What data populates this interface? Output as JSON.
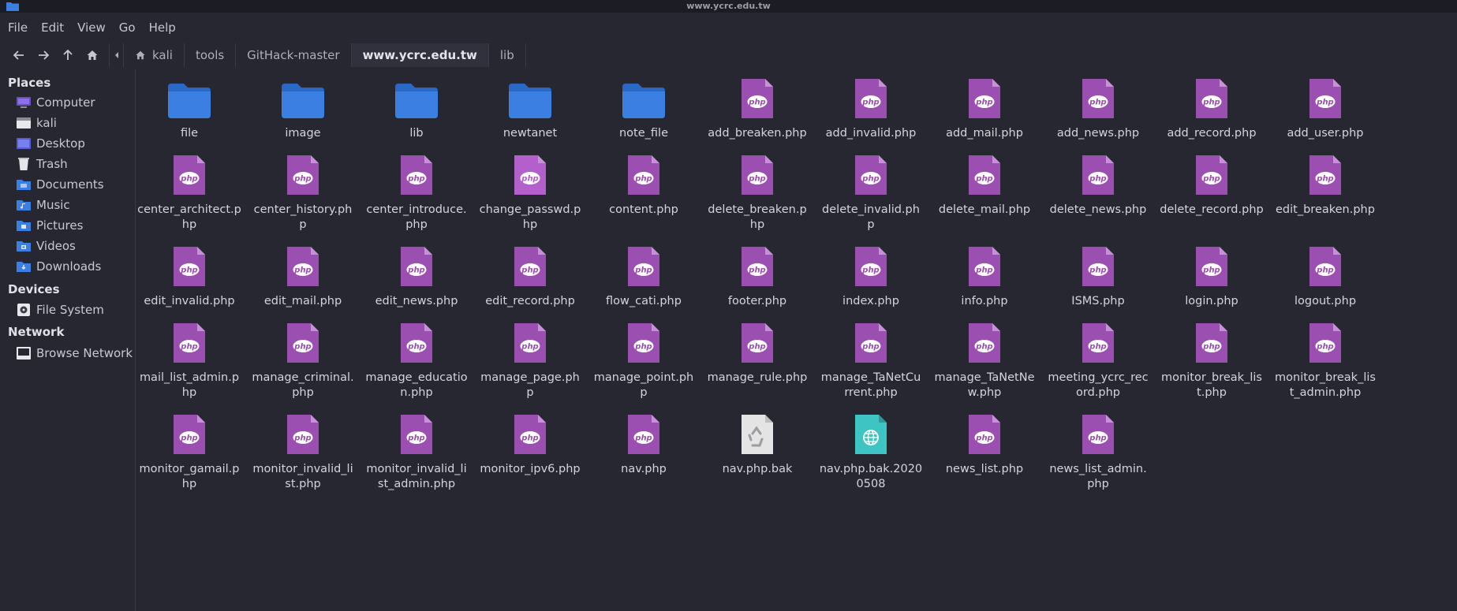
{
  "window": {
    "title": "www.ycrc.edu.tw"
  },
  "menu": [
    "File",
    "Edit",
    "View",
    "Go",
    "Help"
  ],
  "breadcrumbs": [
    {
      "label": "kali",
      "home": true
    },
    {
      "label": "tools"
    },
    {
      "label": "GitHack-master"
    },
    {
      "label": "www.ycrc.edu.tw",
      "current": true
    },
    {
      "label": "lib"
    }
  ],
  "sidebar": {
    "places_label": "Places",
    "places": [
      {
        "label": "Computer",
        "icon": "computer-icon"
      },
      {
        "label": "kali",
        "icon": "home-folder-icon"
      },
      {
        "label": "Desktop",
        "icon": "desktop-icon"
      },
      {
        "label": "Trash",
        "icon": "trash-icon"
      },
      {
        "label": "Documents",
        "icon": "documents-folder-icon"
      },
      {
        "label": "Music",
        "icon": "music-folder-icon"
      },
      {
        "label": "Pictures",
        "icon": "pictures-folder-icon"
      },
      {
        "label": "Videos",
        "icon": "videos-folder-icon"
      },
      {
        "label": "Downloads",
        "icon": "downloads-folder-icon"
      }
    ],
    "devices_label": "Devices",
    "devices": [
      {
        "label": "File System",
        "icon": "drive-icon"
      }
    ],
    "network_label": "Network",
    "network": [
      {
        "label": "Browse Network",
        "icon": "network-icon"
      }
    ]
  },
  "colors": {
    "folder": "#3c7fe3",
    "php": "#9b4fb0",
    "php_light": "#b35fcc",
    "bak": "#e4e4e4",
    "web": "#3fc4c4"
  },
  "files": [
    {
      "name": "file",
      "type": "folder"
    },
    {
      "name": "image",
      "type": "folder"
    },
    {
      "name": "lib",
      "type": "folder"
    },
    {
      "name": "newtanet",
      "type": "folder"
    },
    {
      "name": "note_file",
      "type": "folder"
    },
    {
      "name": "add_breaken.php",
      "type": "php"
    },
    {
      "name": "add_invalid.php",
      "type": "php"
    },
    {
      "name": "add_mail.php",
      "type": "php"
    },
    {
      "name": "add_news.php",
      "type": "php"
    },
    {
      "name": "add_record.php",
      "type": "php"
    },
    {
      "name": "add_user.php",
      "type": "php"
    },
    {
      "name": "center_architect.php",
      "type": "php"
    },
    {
      "name": "center_history.php",
      "type": "php"
    },
    {
      "name": "center_introduce.php",
      "type": "php"
    },
    {
      "name": "change_passwd.php",
      "type": "php-light"
    },
    {
      "name": "content.php",
      "type": "php"
    },
    {
      "name": "delete_breaken.php",
      "type": "php"
    },
    {
      "name": "delete_invalid.php",
      "type": "php"
    },
    {
      "name": "delete_mail.php",
      "type": "php"
    },
    {
      "name": "delete_news.php",
      "type": "php"
    },
    {
      "name": "delete_record.php",
      "type": "php"
    },
    {
      "name": "edit_breaken.php",
      "type": "php"
    },
    {
      "name": "edit_invalid.php",
      "type": "php"
    },
    {
      "name": "edit_mail.php",
      "type": "php"
    },
    {
      "name": "edit_news.php",
      "type": "php"
    },
    {
      "name": "edit_record.php",
      "type": "php"
    },
    {
      "name": "flow_cati.php",
      "type": "php"
    },
    {
      "name": "footer.php",
      "type": "php"
    },
    {
      "name": "index.php",
      "type": "php"
    },
    {
      "name": "info.php",
      "type": "php"
    },
    {
      "name": "ISMS.php",
      "type": "php"
    },
    {
      "name": "login.php",
      "type": "php"
    },
    {
      "name": "logout.php",
      "type": "php"
    },
    {
      "name": "mail_list_admin.php",
      "type": "php"
    },
    {
      "name": "manage_criminal.php",
      "type": "php"
    },
    {
      "name": "manage_education.php",
      "type": "php"
    },
    {
      "name": "manage_page.php",
      "type": "php"
    },
    {
      "name": "manage_point.php",
      "type": "php"
    },
    {
      "name": "manage_rule.php",
      "type": "php"
    },
    {
      "name": "manage_TaNetCurrent.php",
      "type": "php"
    },
    {
      "name": "manage_TaNetNew.php",
      "type": "php"
    },
    {
      "name": "meeting_ycrc_record.php",
      "type": "php"
    },
    {
      "name": "monitor_break_list.php",
      "type": "php"
    },
    {
      "name": "monitor_break_list_admin.php",
      "type": "php"
    },
    {
      "name": "monitor_gamail.php",
      "type": "php"
    },
    {
      "name": "monitor_invalid_list.php",
      "type": "php"
    },
    {
      "name": "monitor_invalid_list_admin.php",
      "type": "php"
    },
    {
      "name": "monitor_ipv6.php",
      "type": "php"
    },
    {
      "name": "nav.php",
      "type": "php"
    },
    {
      "name": "nav.php.bak",
      "type": "bak"
    },
    {
      "name": "nav.php.bak.20200508",
      "type": "web"
    },
    {
      "name": "news_list.php",
      "type": "php"
    },
    {
      "name": "news_list_admin.php",
      "type": "php"
    }
  ]
}
